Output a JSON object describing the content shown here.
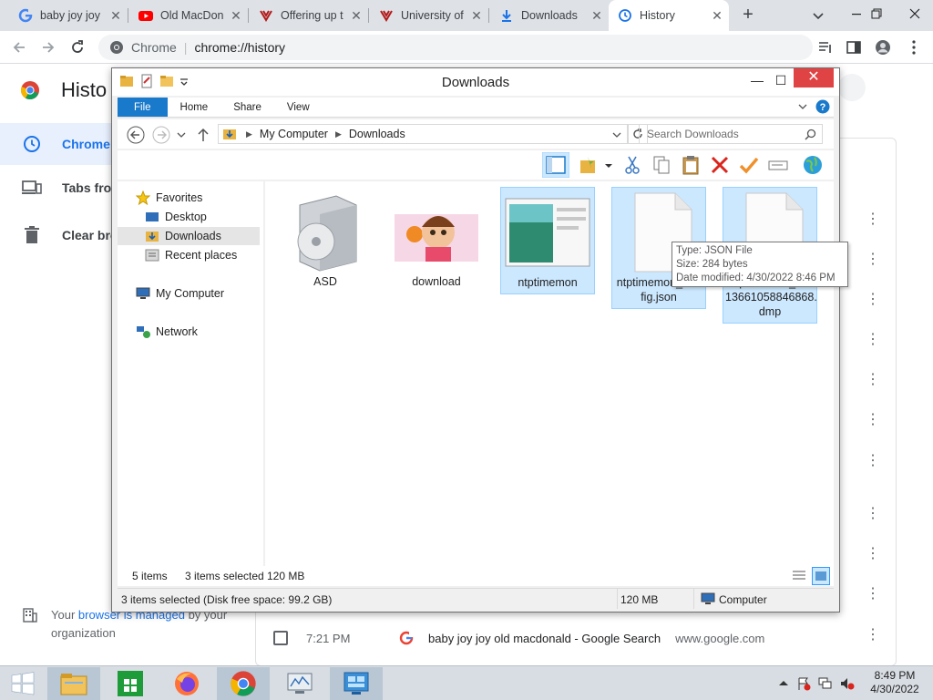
{
  "browser": {
    "tabs": [
      {
        "title": "baby joy joy",
        "icon": "google-g-icon"
      },
      {
        "title": "Old MacDon",
        "icon": "youtube-icon"
      },
      {
        "title": "Offering up t",
        "icon": "offering-site-icon"
      },
      {
        "title": "University of",
        "icon": "university-icon"
      },
      {
        "title": "Downloads",
        "icon": "download-icon"
      },
      {
        "title": "History",
        "icon": "history-icon",
        "active": true
      }
    ],
    "new_tab": "+",
    "close_glyph": "✕",
    "omnibox": {
      "site": "Chrome",
      "separator": "|",
      "url": "chrome://history"
    }
  },
  "history_page": {
    "title": "Histo",
    "sidebar": [
      {
        "label": "Chrome",
        "icon": "clock-icon",
        "active": true
      },
      {
        "label": "Tabs fro",
        "icon": "devices-icon"
      },
      {
        "label": "Clear bro",
        "icon": "trash-icon"
      }
    ],
    "managed_text_prefix": "Your ",
    "managed_link": "browser is managed",
    "managed_text_suffix": " by your organization",
    "entry": {
      "time": "7:21 PM",
      "title": "baby joy joy old macdonald - Google Search",
      "domain": "www.google.com"
    }
  },
  "explorer": {
    "title": "Downloads",
    "ribbon_tabs": [
      "File",
      "Home",
      "Share",
      "View"
    ],
    "breadcrumb": [
      "My Computer",
      "Downloads"
    ],
    "search_placeholder": "Search Downloads",
    "nav": {
      "favorites": "Favorites",
      "desktop": "Desktop",
      "downloads": "Downloads",
      "recent": "Recent places",
      "computer": "My Computer",
      "network": "Network"
    },
    "files": [
      {
        "name": "ASD",
        "type": "installer-box",
        "selected": false
      },
      {
        "name": "download",
        "type": "cartoon-image",
        "selected": false
      },
      {
        "name": "ntptimemon",
        "type": "app-window",
        "selected": true
      },
      {
        "name": "ntptimemon_config.json",
        "line1": "ntptimemon_con",
        "line2": "fig.json",
        "type": "blank-file",
        "selected": true
      },
      {
        "name": "ntptimemon_ids13661058846868.dmp",
        "line1": "ntptimemon_ids",
        "line2": "13661058846868.",
        "line3": "dmp",
        "type": "blank-file",
        "selected": true
      }
    ],
    "tooltip": {
      "type": "Type: JSON File",
      "size": "Size: 284 bytes",
      "modified": "Date modified: 4/30/2022 8:46 PM"
    },
    "info": {
      "items": "5 items",
      "selected": "3 items selected",
      "size": "120 MB"
    },
    "status": {
      "left": "3 items selected (Disk free space: 99.2 GB)",
      "size": "120 MB",
      "location": "Computer"
    }
  },
  "taskbar": {
    "apps": [
      "file-explorer-icon",
      "store-icon",
      "firefox-icon",
      "chrome-icon",
      "monitor-icon",
      "control-panel-icon"
    ],
    "time": "8:49 PM",
    "date": "4/30/2022"
  }
}
